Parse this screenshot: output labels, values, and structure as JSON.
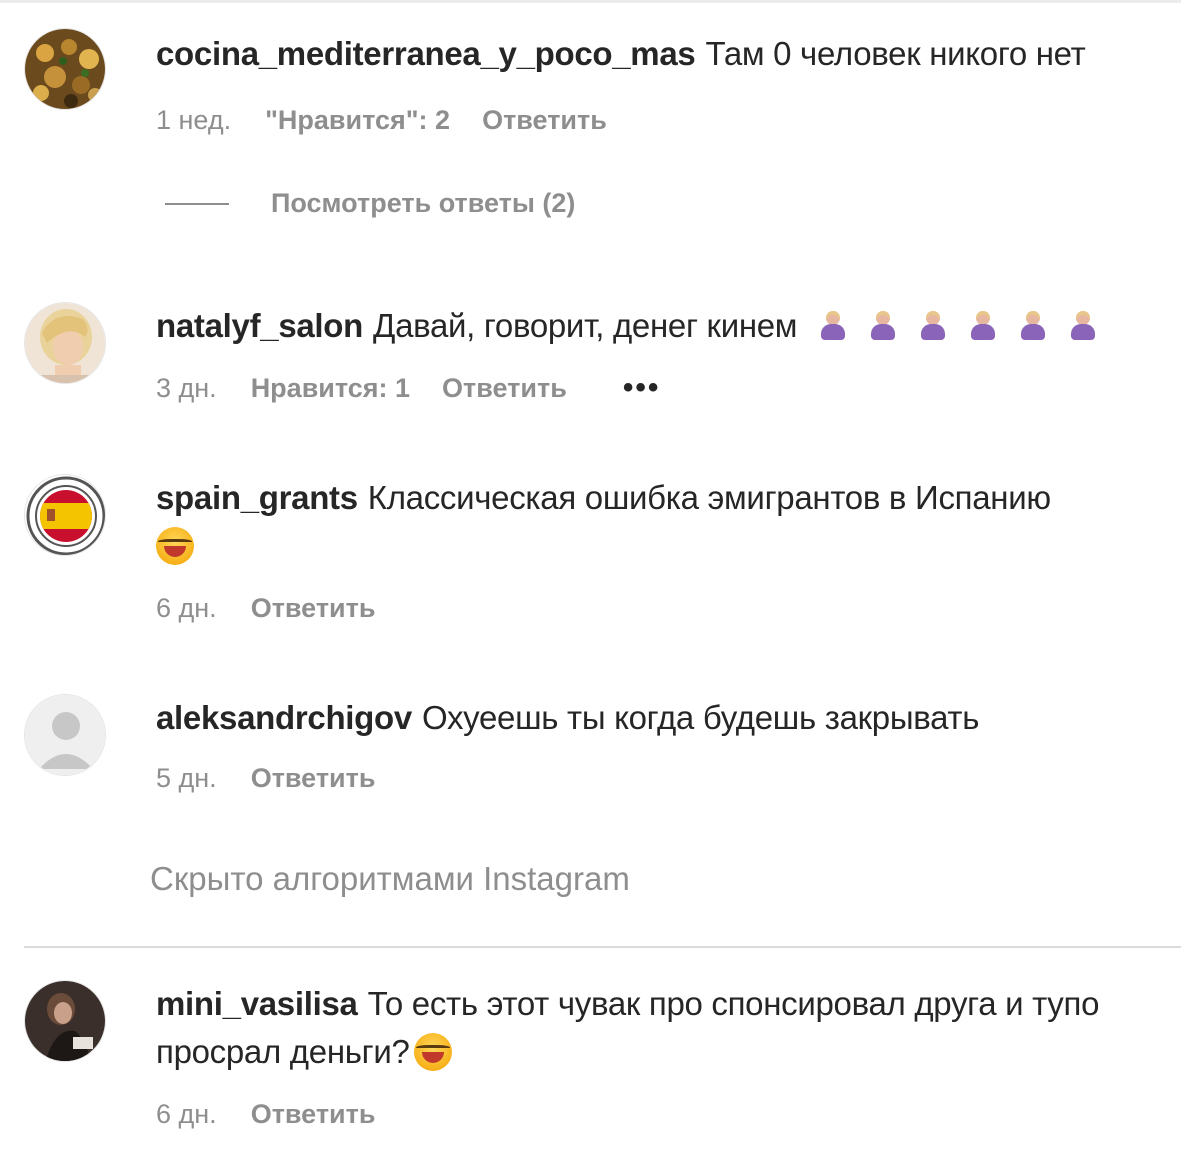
{
  "comments": [
    {
      "username": "cocina_mediterranea_y_poco_mas",
      "text": "Там 0 человек никого нет",
      "time": "1 нед.",
      "likes": "\"Нравится\": 2",
      "reply": "Ответить",
      "view_replies": "Посмотреть ответы (2)"
    },
    {
      "username": "natalyf_salon",
      "text": "Давай, говорит, денег кинем",
      "time": "3 дн.",
      "likes": "Нравится: 1",
      "reply": "Ответить",
      "more": "•••"
    },
    {
      "username": "spain_grants",
      "text": "Классическая ошибка эмигрантов в Испанию",
      "time": "6 дн.",
      "reply": "Ответить"
    },
    {
      "username": "aleksandrchigov",
      "text": "Охуеешь ты когда будешь закрывать",
      "time": "5 дн.",
      "reply": "Ответить"
    },
    {
      "username": "mini_vasilisa",
      "text": "То есть этот чувак про спонсировал друга и тупо просрал деньги?",
      "time": "6 дн.",
      "reply": "Ответить"
    }
  ],
  "hidden_note": "Скрыто алгоритмами Instagram"
}
